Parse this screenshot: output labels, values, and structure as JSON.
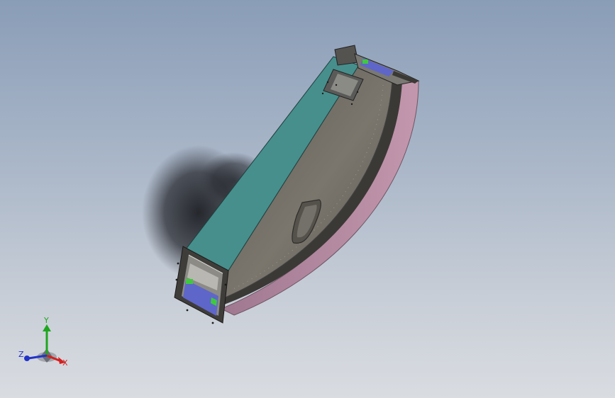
{
  "viewport": {
    "background_top": "#8a9db7",
    "background_bottom": "#d9dce1"
  },
  "model": {
    "top_face_color": "#468f8c",
    "side_face_color": "#6d6a62",
    "flange_color": "#3f3d3a",
    "curved_strip_color": "#b3879e",
    "interior_blue": "#5e66c9",
    "interior_green": "#3fc93f"
  },
  "triad": {
    "x_label": "X",
    "y_label": "Y",
    "z_label": "Z",
    "x_color": "#d32020",
    "y_color": "#1fa61f",
    "z_color": "#2233c8"
  }
}
